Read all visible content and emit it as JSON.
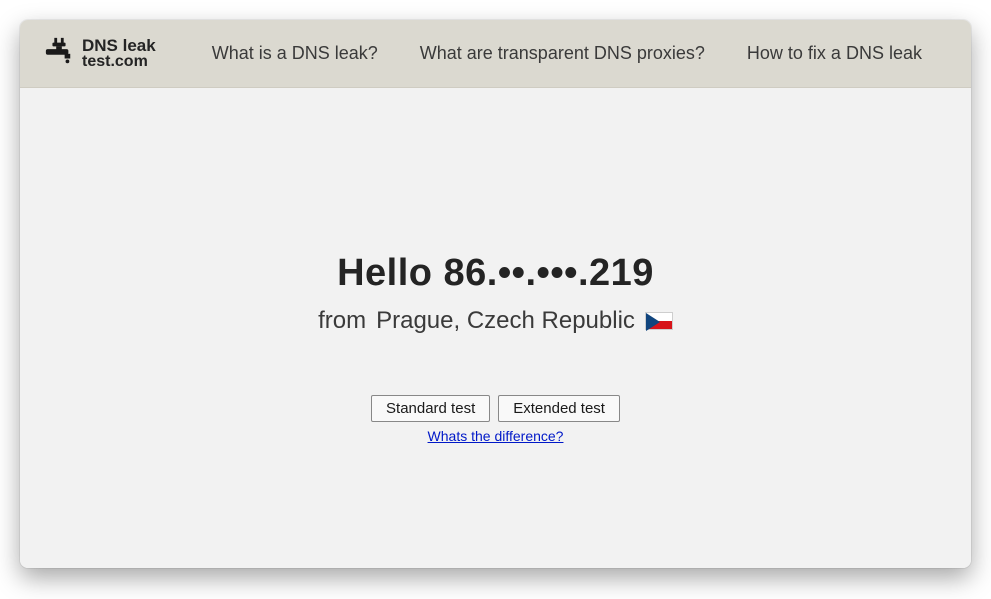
{
  "logo": {
    "line1": "DNS leak",
    "line2": "test.com"
  },
  "nav": {
    "link1": "What is a DNS leak?",
    "link2": "What are transparent DNS proxies?",
    "link3": "How to fix a DNS leak"
  },
  "main": {
    "greeting": "Hello 86.••.•••.219",
    "location_prefix": "from ",
    "location": "Prague, Czech Republic",
    "flag": "czech-republic"
  },
  "buttons": {
    "standard": "Standard test",
    "extended": "Extended test"
  },
  "links": {
    "difference": "Whats the difference?"
  }
}
